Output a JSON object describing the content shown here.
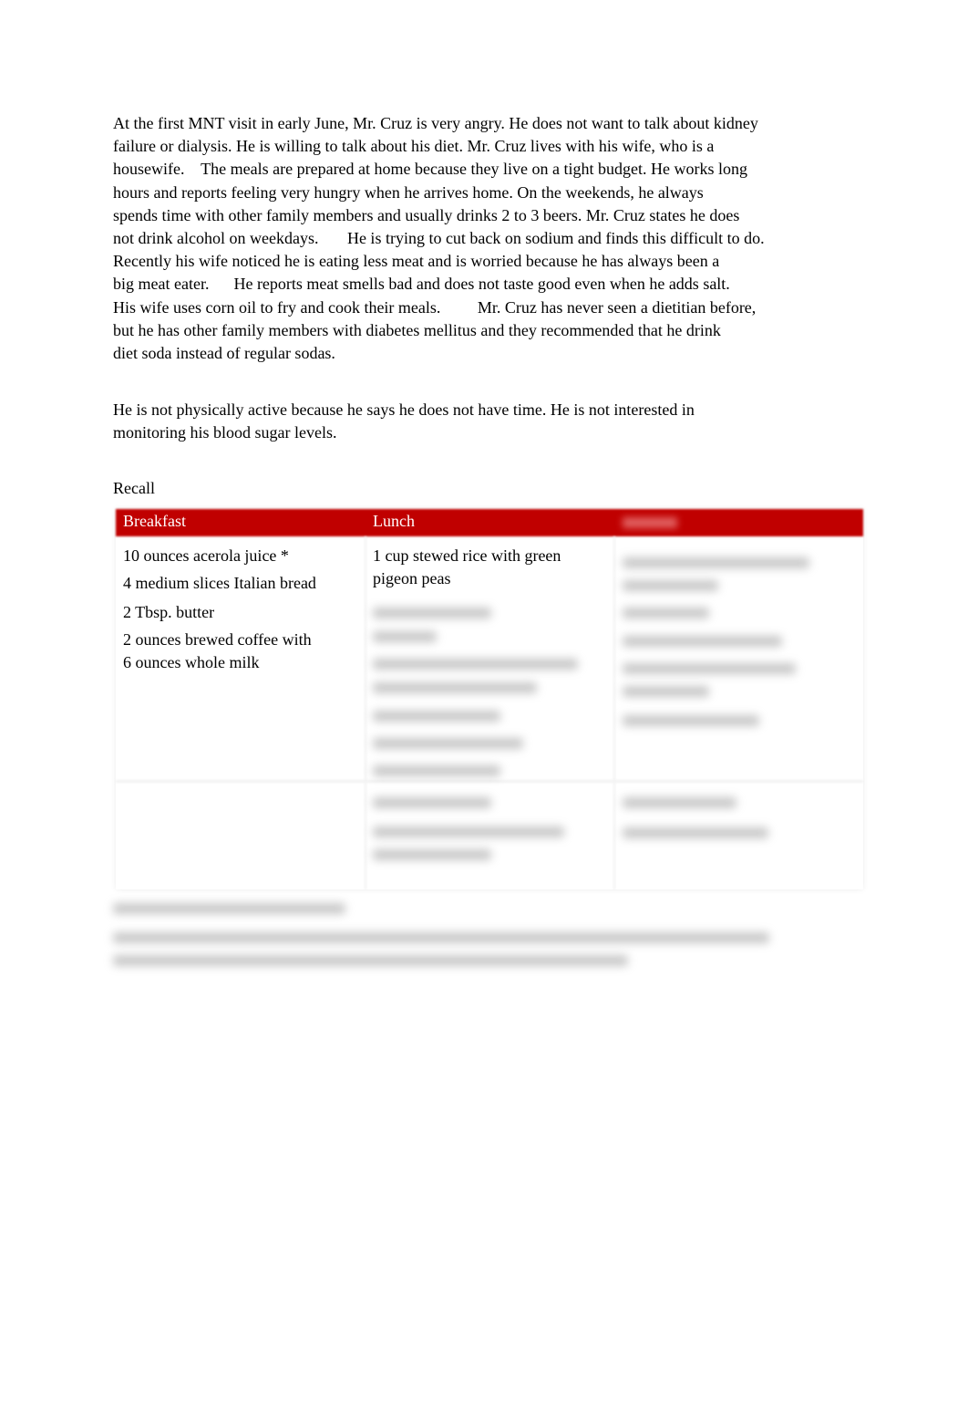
{
  "paragraph1": [
    "At the first MNT visit in early June, Mr. Cruz is very angry. He does not want to talk about kidney",
    "failure or dialysis. He is willing to talk about his diet. Mr. Cruz lives with his wife, who is a",
    "housewife.    The meals are prepared at home because they live on a tight budget. He works long",
    "hours and reports feeling very hungry when he arrives home. On the weekends, he always",
    "spends time with other family members and usually drinks 2 to 3 beers. Mr. Cruz states he does",
    "not drink alcohol on weekdays.       He is trying to cut back on sodium and finds this difficult to do.",
    "Recently his wife noticed he is eating less meat and is worried because he has always been a",
    "big meat eater.      He reports meat smells bad and does not taste good even when he adds salt.",
    "His wife uses corn oil to fry and cook their meals.         Mr. Cruz has never seen a dietitian before,",
    "but he has other family members with diabetes mellitus and they recommended that he drink",
    "diet soda instead of regular sodas."
  ],
  "paragraph2": [
    "He is not physically active because he says he does not have time. He is not interested in",
    "monitoring his blood sugar levels."
  ],
  "recall_label": "Recall",
  "table": {
    "header_color": "#c00000",
    "headers": [
      "Breakfast",
      "Lunch"
    ],
    "breakfast": [
      "10 ounces acerola juice *",
      "4 medium slices Italian bread",
      "2 Tbsp. butter",
      "2 ounces brewed coffee with\n6 ounces whole milk"
    ],
    "lunch": [
      "1 cup stewed rice with green\npigeon peas"
    ]
  }
}
